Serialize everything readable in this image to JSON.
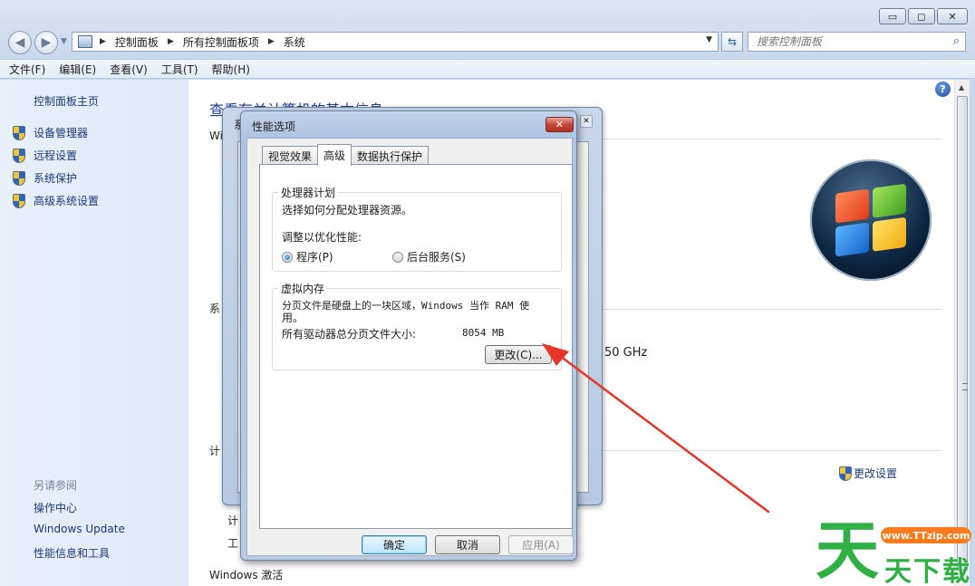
{
  "window": {
    "controls": {
      "minimize": "▭",
      "maximize": "◻",
      "close": "✕"
    }
  },
  "nav": {
    "back": "◀",
    "forward": "▶",
    "breadcrumbs": [
      "控制面板",
      "所有控制面板项",
      "系统"
    ],
    "search_placeholder": "搜索控制面板"
  },
  "menu": {
    "items": [
      "文件(F)",
      "编辑(E)",
      "查看(V)",
      "工具(T)",
      "帮助(H)"
    ]
  },
  "sidebar": {
    "home": "控制面板主页",
    "items": [
      {
        "label": "设备管理器",
        "icon": "shield-icon"
      },
      {
        "label": "远程设置",
        "icon": "shield-icon"
      },
      {
        "label": "系统保护",
        "icon": "shield-icon"
      },
      {
        "label": "高级系统设置",
        "icon": "shield-icon"
      }
    ],
    "see_also": "另请参阅",
    "links": [
      "操作中心",
      "Windows Update",
      "性能信息和工具"
    ]
  },
  "main": {
    "heading": "查看有关计算机的基本信息",
    "section_win": "Wi",
    "section_sys": "系",
    "section_comp": "计",
    "cpu_speed": "50 GHz",
    "change_settings": "更改设置",
    "row_ji": "计",
    "row_gong": "工",
    "activation": "Windows 激活"
  },
  "system_properties": {
    "title": "系",
    "close": "✕"
  },
  "performance_options": {
    "title": "性能选项",
    "close": "✕",
    "tabs": [
      "视觉效果",
      "高级",
      "数据执行保护"
    ],
    "active_tab": "高级",
    "processor": {
      "group_title": "处理器计划",
      "desc": "选择如何分配处理器资源。",
      "adjust_label": "调整以优化性能:",
      "option_programs": "程序(P)",
      "option_services": "后台服务(S)",
      "selected": "programs"
    },
    "virtual_memory": {
      "group_title": "虚拟内存",
      "desc_line1": "分页文件是硬盘上的一块区域，Windows 当作 RAM 使",
      "desc_line2": "用。",
      "total_label": "所有驱动器总分页文件大小:",
      "total_value": "8054 MB",
      "change_button": "更改(C)..."
    },
    "buttons": {
      "ok": "确定",
      "cancel": "取消",
      "apply": "应用(A)"
    }
  },
  "annotation": {
    "arrow_color": "#e8352a"
  },
  "watermark": {
    "big": "天",
    "pill": "www.TTzip.com",
    "small": "天下载"
  },
  "colors": {
    "link": "#1a3a78",
    "heading": "#1e3f93",
    "accent_close": "#c6473a"
  }
}
